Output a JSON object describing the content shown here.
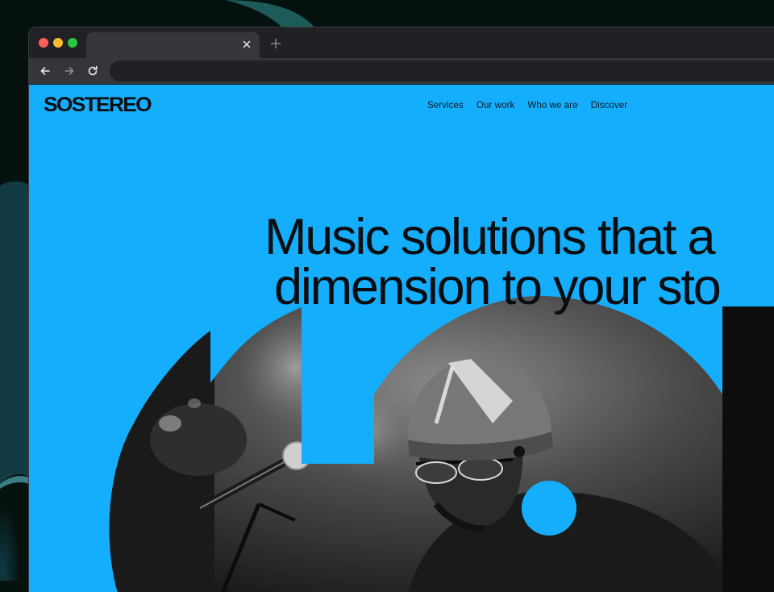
{
  "site": {
    "logo_text": "SOSTEREO",
    "nav": [
      {
        "label": "Services"
      },
      {
        "label": "Our work"
      },
      {
        "label": "Who we are"
      },
      {
        "label": "Discover"
      }
    ],
    "hero": {
      "headline_line1": "Music solutions that a",
      "headline_line2": "dimension to your sto"
    }
  },
  "colors": {
    "brand_blue": "#14aefd",
    "text_dark": "#0a0d10",
    "browser_dark": "#202124"
  },
  "icons": {
    "tab_close": "close-icon",
    "new_tab": "plus-icon",
    "back": "arrow-left-icon",
    "forward": "arrow-right-icon",
    "reload": "reload-icon"
  }
}
